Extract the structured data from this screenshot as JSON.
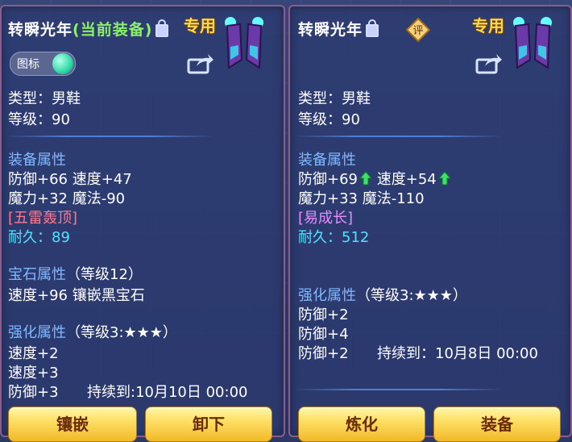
{
  "panels": [
    {
      "title_name": "转瞬光年",
      "title_status": "(当前装备)",
      "special_label": "专用",
      "icon_toggle_label": "图标",
      "type_line": "类型：男鞋",
      "level_line": "等级：90",
      "equip_header": "装备属性",
      "stat_line_1": "防御+66 速度+47",
      "stat_line_2": "魔力+32 魔法-90",
      "skill": "[五雷轰顶]",
      "durability_label": "耐久：",
      "durability_value": "89",
      "gem_header": "宝石属性",
      "gem_level": "（等级12）",
      "gem_line": "速度+96 镶嵌黑宝石",
      "enhance_header": "强化属性",
      "enhance_level": "（等级3:★★★）",
      "enhance_1": "速度+2",
      "enhance_2": "速度+3",
      "enhance_3": "防御+3",
      "enhance_3_duration": "持续到:10月10日 00:00",
      "buttons": [
        "镶嵌",
        "卸下"
      ]
    },
    {
      "title_name": "转瞬光年",
      "rate_label": "评",
      "special_label": "专用",
      "type_line": "类型：男鞋",
      "level_line": "等级：90",
      "equip_header": "装备属性",
      "stat_1a": "防御+69",
      "stat_1b": "速度+54",
      "stat_line_2": "魔力+33 魔法-110",
      "skill": "[易成长]",
      "durability_label": "耐久：",
      "durability_value": "512",
      "enhance_header": "强化属性",
      "enhance_level": "（等级3:★★★）",
      "enhance_1": "防御+2",
      "enhance_2": "防御+4",
      "enhance_3": "防御+2",
      "enhance_3_duration": "持续到：10月8日 00:00",
      "buttons": [
        "炼化",
        "装备"
      ]
    }
  ],
  "colors": {
    "accent_green": "#8cf06a",
    "header_blue": "#7fb9ff",
    "durability": "#4fe3ff",
    "skill_red": "#ff7890",
    "skill_pink": "#e88cff",
    "special_gold": "#ffd84a"
  },
  "icons": [
    "lock-icon",
    "boots-item-icon",
    "share-icon",
    "rating-icon",
    "stat-up-arrow-icon"
  ]
}
